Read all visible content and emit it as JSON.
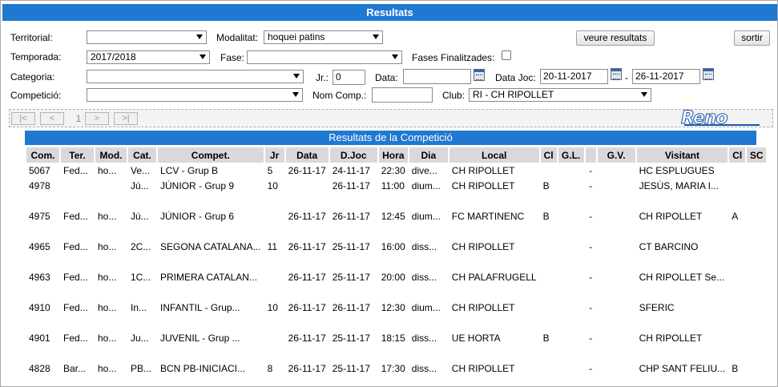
{
  "title": "Resultats",
  "filters": {
    "territorial_label": "Territorial:",
    "territorial_value": "",
    "modalitat_label": "Modalitat:",
    "modalitat_value": "hoquei patins",
    "veure_button": "veure resultats",
    "sortir_button": "sortir",
    "temporada_label": "Temporada:",
    "temporada_value": "2017/2018",
    "fase_label": "Fase:",
    "fase_value": "",
    "fases_finalitzades_label": "Fases Finalitzades:",
    "categoria_label": "Categoria:",
    "categoria_value": "",
    "jr_label": "Jr.:",
    "jr_value": "0",
    "data_label": "Data:",
    "data_value": "",
    "data_joc_label": "Data Joc:",
    "data_joc_from": "20-11-2017",
    "data_joc_sep": "-",
    "data_joc_to": "26-11-2017",
    "competicio_label": "Competició:",
    "competicio_value": "",
    "nom_comp_label": "Nom Comp.:",
    "nom_comp_value": "",
    "club_label": "Club:",
    "club_value": "RI - CH RIPOLLET"
  },
  "pager": {
    "first": "|<",
    "prev": "<",
    "page": "1",
    "next": ">",
    "last": ">|",
    "logo": "Reno"
  },
  "results_title": "Resultats de la Competició",
  "columns": [
    "Com.",
    "Ter.",
    "Mod.",
    "Cat.",
    "Compet.",
    "Jr",
    "Data",
    "D.Joc",
    "Hora",
    "Dia",
    "Local",
    "Cl",
    "G.L.",
    "",
    "G.V.",
    "Visitant",
    "Cl",
    "SC"
  ],
  "rows": [
    [
      "5067",
      "Fed...",
      "ho...",
      "Ve...",
      "LCV - Grup B",
      "5",
      "26-11-17",
      "24-11-17",
      "22:30",
      "dive...",
      "CH RIPOLLET",
      "",
      "",
      "-",
      "",
      "HC ESPLUGUES",
      "",
      ""
    ],
    [
      "4978",
      "",
      "",
      "Jú...",
      "JÚNIOR - Grup 9",
      "10",
      "",
      "26-11-17",
      "11:00",
      "dium...",
      "CH RIPOLLET",
      "B",
      "",
      "-",
      "",
      "JESÚS, MARIA I...",
      "",
      ""
    ],
    [
      "4975",
      "Fed...",
      "ho...",
      "Jú...",
      "JÚNIOR - Grup 6",
      "",
      "26-11-17",
      "26-11-17",
      "12:45",
      "dium...",
      "FC MARTINENC",
      "B",
      "",
      "-",
      "",
      "CH RIPOLLET",
      "A",
      ""
    ],
    [
      "4965",
      "Fed...",
      "ho...",
      "2C...",
      "SEGONA CATALANA...",
      "11",
      "26-11-17",
      "25-11-17",
      "16:00",
      "diss...",
      "CH RIPOLLET",
      "",
      "",
      "-",
      "",
      "CT BARCINO",
      "",
      ""
    ],
    [
      "4963",
      "Fed...",
      "ho...",
      "1C...",
      "PRIMERA CATALAN...",
      "",
      "26-11-17",
      "25-11-17",
      "20:00",
      "diss...",
      "CH PALAFRUGELL",
      "",
      "",
      "-",
      "",
      "CH RIPOLLET Se...",
      "",
      ""
    ],
    [
      "4910",
      "Fed...",
      "ho...",
      "In...",
      "INFANTIL - Grup...",
      "10",
      "26-11-17",
      "26-11-17",
      "12:30",
      "dium...",
      "CH RIPOLLET",
      "",
      "",
      "-",
      "",
      "SFERIC",
      "",
      ""
    ],
    [
      "4901",
      "Fed...",
      "ho...",
      "Ju...",
      "JUVENIL - Grup ...",
      "",
      "26-11-17",
      "25-11-17",
      "18:15",
      "diss...",
      "UE HORTA",
      "B",
      "",
      "-",
      "",
      "CH RIPOLLET",
      "",
      ""
    ],
    [
      "4828",
      "Bar...",
      "ho...",
      "PB...",
      "BCN PB-INICIACI...",
      "8",
      "26-11-17",
      "25-11-17",
      "17:30",
      "diss...",
      "CH RIPOLLET",
      "",
      "",
      "-",
      "",
      "CHP SANT FELIU...",
      "B",
      ""
    ]
  ]
}
